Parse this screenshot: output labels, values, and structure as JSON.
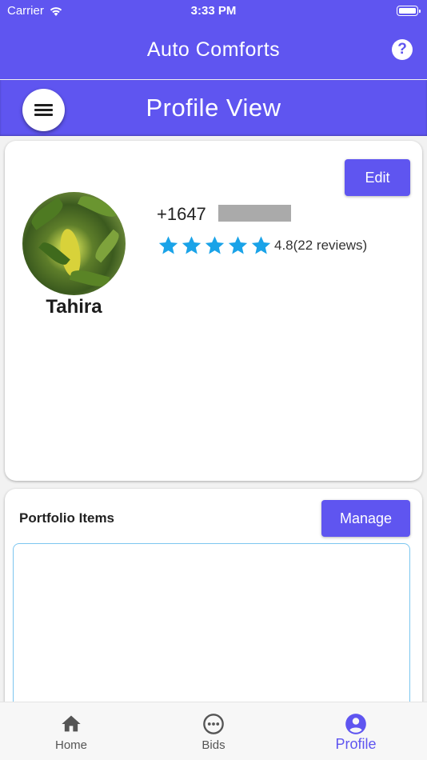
{
  "status_bar": {
    "carrier": "Carrier",
    "time": "3:33 PM"
  },
  "app_bar": {
    "title": "Auto Comforts",
    "help_icon": "help-circle-icon"
  },
  "sub_bar": {
    "title": "Profile View",
    "menu_icon": "hamburger-menu-icon"
  },
  "profile": {
    "edit_label": "Edit",
    "name": "Tahira",
    "phone_visible": "+1647",
    "rating": 4.8,
    "stars_filled": 5,
    "rating_text": "4.8(22 reviews)",
    "star_color": "#1aa3e8"
  },
  "portfolio": {
    "title": "Portfolio Items",
    "manage_label": "Manage"
  },
  "tabs": [
    {
      "label": "Home",
      "icon": "home-icon"
    },
    {
      "label": "Bids",
      "icon": "chat-bubble-icon"
    },
    {
      "label": "Profile",
      "icon": "account-circle-icon",
      "active": true
    }
  ],
  "colors": {
    "primary": "#5f55f0",
    "accent_outline": "#7cc6f0"
  }
}
